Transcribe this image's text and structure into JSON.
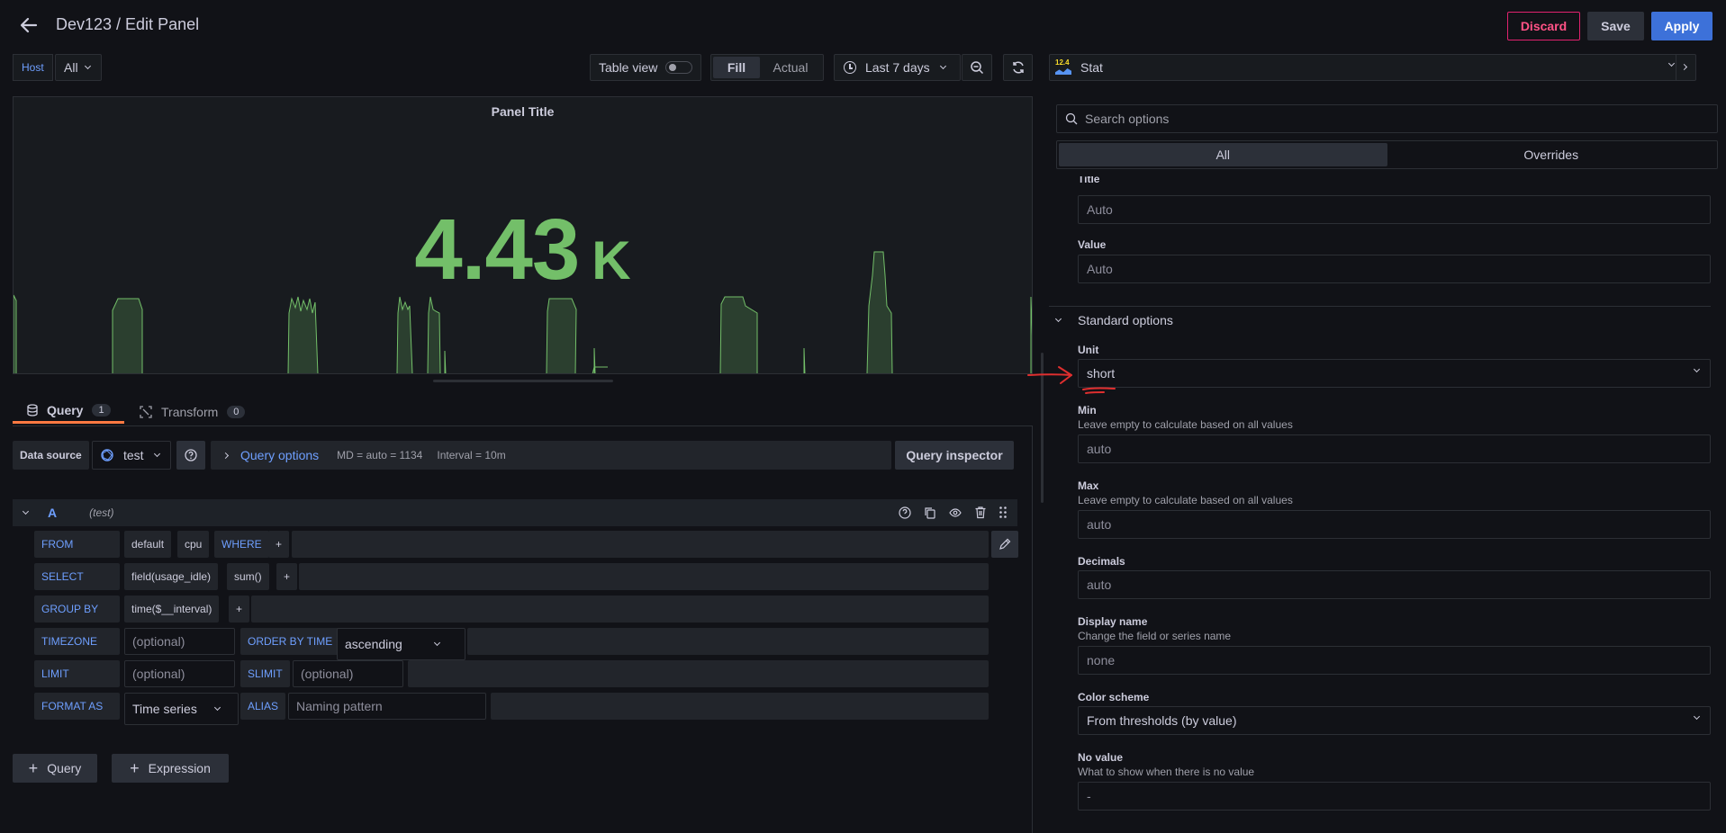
{
  "header": {
    "breadcrumb": "Dev123 / Edit Panel",
    "discard_label": "Discard",
    "save_label": "Save",
    "apply_label": "Apply"
  },
  "variables": {
    "host_label": "Host",
    "host_value": "All"
  },
  "toolbar": {
    "table_view_label": "Table view",
    "fill_label": "Fill",
    "actual_label": "Actual",
    "time_range": "Last 7 days"
  },
  "panel": {
    "title": "Panel Title",
    "value": "4.43",
    "unit_suffix": "K",
    "value_color": "#73bf69"
  },
  "query_tabs": {
    "query_label": "Query",
    "query_count": "1",
    "transform_label": "Transform",
    "transform_count": "0"
  },
  "query_bar": {
    "data_source_label": "Data source",
    "data_source_value": "test",
    "query_options_label": "Query options",
    "md_info": "MD = auto = 1134",
    "interval_info": "Interval = 10m",
    "inspector_label": "Query inspector"
  },
  "query_row": {
    "ref_id": "A",
    "source_name": "(test)",
    "from_kw": "FROM",
    "from_db": "default",
    "from_measurement": "cpu",
    "where_kw": "WHERE",
    "plus": "+",
    "select_kw": "SELECT",
    "select_field": "field(usage_idle)",
    "select_fn": "sum()",
    "group_by_kw": "GROUP BY",
    "group_by_value": "time($__interval)",
    "timezone_kw": "TIMEZONE",
    "timezone_placeholder": "(optional)",
    "order_kw": "ORDER BY TIME",
    "order_value": "ascending",
    "limit_kw": "LIMIT",
    "limit_placeholder": "(optional)",
    "slimit_kw": "SLIMIT",
    "slimit_placeholder": "(optional)",
    "format_kw": "FORMAT AS",
    "format_value": "Time series",
    "alias_kw": "ALIAS",
    "alias_placeholder": "Naming pattern"
  },
  "bottom_buttons": {
    "add_query": "Query",
    "add_expression": "Expression"
  },
  "options": {
    "viz_version": "12.4",
    "viz_name": "Stat",
    "search_placeholder": "Search options",
    "tab_all": "All",
    "tab_overrides": "Overrides",
    "title_label": "Title",
    "title_value": "Auto",
    "value_label": "Value",
    "value_value": "Auto",
    "standard_options_label": "Standard options",
    "unit_label": "Unit",
    "unit_value": "short",
    "min_label": "Min",
    "min_desc": "Leave empty to calculate based on all values",
    "min_value": "auto",
    "max_label": "Max",
    "max_desc": "Leave empty to calculate based on all values",
    "max_value": "auto",
    "decimals_label": "Decimals",
    "decimals_value": "auto",
    "display_name_label": "Display name",
    "display_name_desc": "Change the field or series name",
    "display_name_value": "none",
    "color_scheme_label": "Color scheme",
    "color_scheme_value": "From thresholds (by value)",
    "no_value_label": "No value",
    "no_value_desc": "What to show when there is no value",
    "no_value_value": "-"
  },
  "colors": {
    "accent": "#3d71d9",
    "discard": "#e0226e",
    "series": "#73bf69"
  }
}
